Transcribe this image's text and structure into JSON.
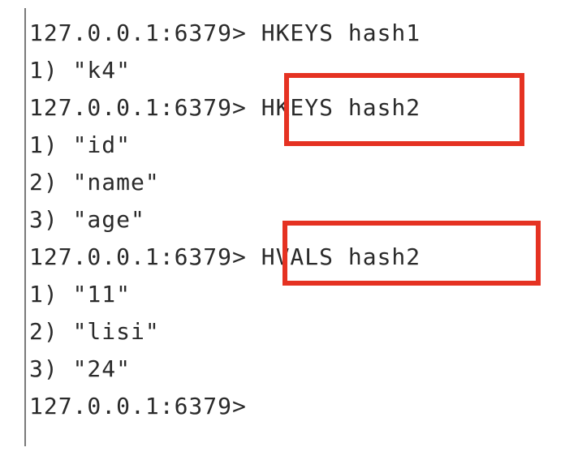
{
  "terminal": {
    "lines": [
      "127.0.0.1:6379> HKEYS hash1",
      "1) \"k4\"",
      "127.0.0.1:6379> HKEYS hash2",
      "1) \"id\"",
      "2) \"name\"",
      "3) \"age\"",
      "127.0.0.1:6379> HVALS hash2",
      "1) \"11\"",
      "2) \"lisi\"",
      "3) \"24\"",
      "127.0.0.1:6379>"
    ]
  },
  "highlight_color": "#e53222"
}
